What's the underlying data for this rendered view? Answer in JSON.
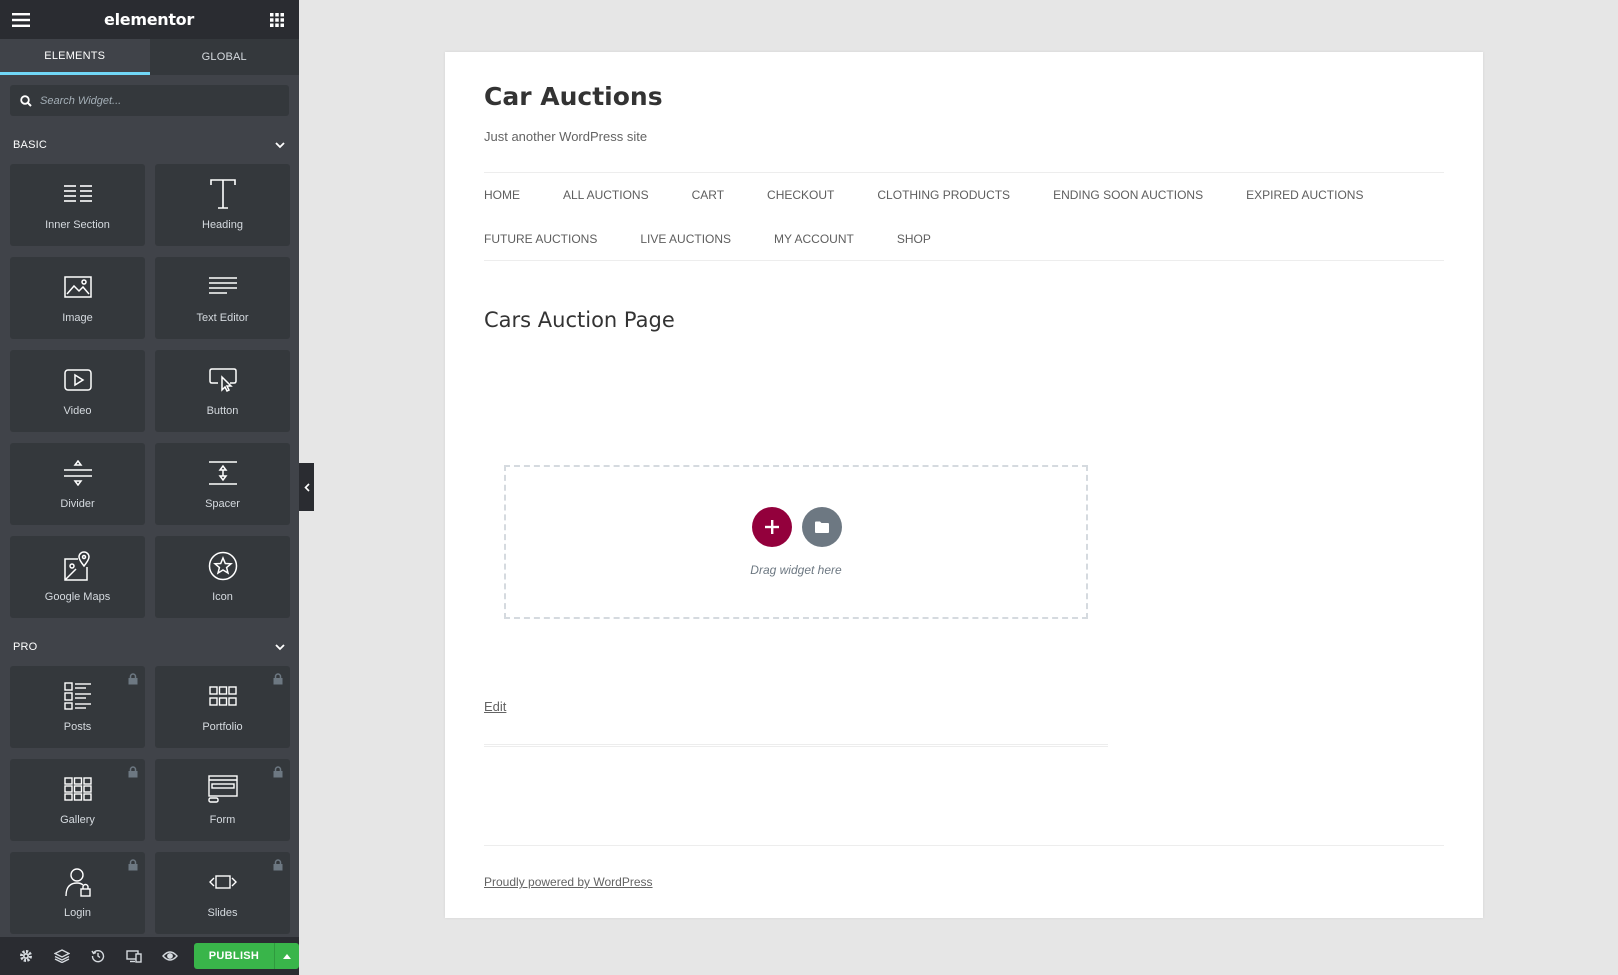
{
  "panel": {
    "logo": "elementor",
    "tabs": [
      {
        "label": "ELEMENTS",
        "active": true
      },
      {
        "label": "GLOBAL",
        "active": false
      }
    ],
    "search": {
      "placeholder": "Search Widget..."
    },
    "categories": [
      {
        "name": "BASIC",
        "widgets": [
          {
            "label": "Inner Section",
            "icon": "inner-section-icon"
          },
          {
            "label": "Heading",
            "icon": "heading-icon"
          },
          {
            "label": "Image",
            "icon": "image-icon"
          },
          {
            "label": "Text Editor",
            "icon": "text-editor-icon"
          },
          {
            "label": "Video",
            "icon": "video-icon"
          },
          {
            "label": "Button",
            "icon": "button-icon"
          },
          {
            "label": "Divider",
            "icon": "divider-icon"
          },
          {
            "label": "Spacer",
            "icon": "spacer-icon"
          },
          {
            "label": "Google Maps",
            "icon": "google-maps-icon"
          },
          {
            "label": "Icon",
            "icon": "star-icon"
          }
        ]
      },
      {
        "name": "PRO",
        "widgets": [
          {
            "label": "Posts",
            "icon": "posts-icon",
            "locked": true
          },
          {
            "label": "Portfolio",
            "icon": "portfolio-icon",
            "locked": true
          },
          {
            "label": "Gallery",
            "icon": "gallery-icon",
            "locked": true
          },
          {
            "label": "Form",
            "icon": "form-icon",
            "locked": true
          },
          {
            "label": "Login",
            "icon": "login-icon",
            "locked": true
          },
          {
            "label": "Slides",
            "icon": "slides-icon",
            "locked": true
          }
        ]
      }
    ],
    "footer": {
      "publish_label": "PUBLISH"
    }
  },
  "site": {
    "title": "Car Auctions",
    "description": "Just another WordPress site",
    "nav_row1": [
      "HOME",
      "ALL AUCTIONS",
      "CART",
      "CHECKOUT",
      "CLOTHING PRODUCTS",
      "ENDING SOON AUCTIONS",
      "EXPIRED AUCTIONS"
    ],
    "nav_row2": [
      "FUTURE AUCTIONS",
      "LIVE AUCTIONS",
      "MY ACCOUNT",
      "SHOP"
    ],
    "page_title": "Cars Auction Page",
    "dropzone_text": "Drag widget here",
    "edit_label": "Edit",
    "footer_text": "Proudly powered by WordPress"
  },
  "colors": {
    "panel_bg": "#404349",
    "accent_tab": "#71d7f7",
    "publish": "#39b54a",
    "add_button": "#93003c",
    "template_button": "#6d7882"
  }
}
